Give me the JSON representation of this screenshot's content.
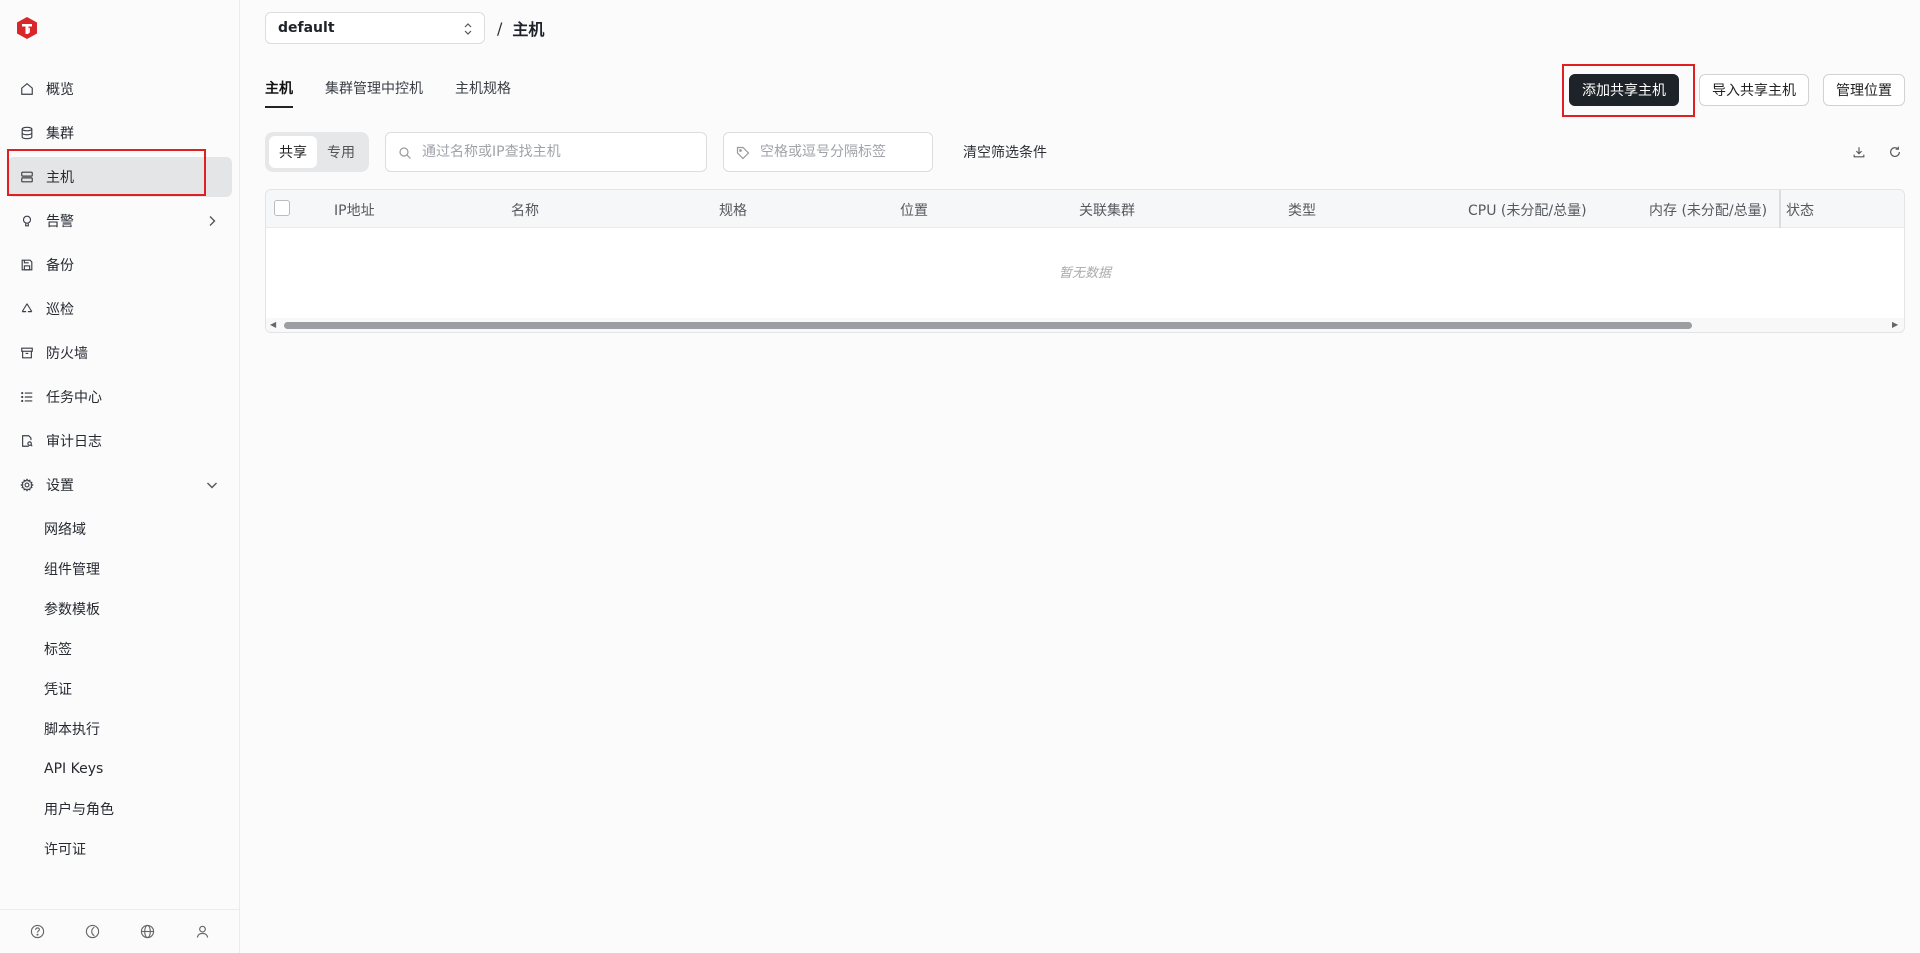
{
  "sidebar": {
    "items": [
      {
        "label": "概览",
        "icon": "home-icon"
      },
      {
        "label": "集群",
        "icon": "database-icon"
      },
      {
        "label": "主机",
        "icon": "server-icon"
      },
      {
        "label": "告警",
        "icon": "bulb-icon"
      },
      {
        "label": "备份",
        "icon": "save-icon"
      },
      {
        "label": "巡检",
        "icon": "recycle-icon"
      },
      {
        "label": "防火墙",
        "icon": "archive-icon"
      },
      {
        "label": "任务中心",
        "icon": "list-icon"
      },
      {
        "label": "审计日志",
        "icon": "file-search-icon"
      },
      {
        "label": "设置",
        "icon": "gear-icon"
      }
    ],
    "settings_children": [
      "网络域",
      "组件管理",
      "参数模板",
      "标签",
      "凭证",
      "脚本执行",
      "API Keys",
      "用户与角色",
      "许可证"
    ],
    "footer_icons": [
      "help-icon",
      "theme-icon",
      "globe-icon",
      "user-icon"
    ]
  },
  "header": {
    "namespace": "default",
    "separator": "/",
    "title": "主机"
  },
  "tabs": [
    "主机",
    "集群管理中控机",
    "主机规格"
  ],
  "actions": {
    "add_shared": "添加共享主机",
    "import_shared": "导入共享主机",
    "manage_location": "管理位置"
  },
  "filters": {
    "segment": [
      "共享",
      "专用"
    ],
    "search_placeholder": "通过名称或IP查找主机",
    "tag_placeholder": "空格或逗号分隔标签",
    "clear": "清空筛选条件"
  },
  "table": {
    "columns": [
      "IP地址",
      "名称",
      "规格",
      "位置",
      "关联集群",
      "类型",
      "CPU (未分配/总量)",
      "内存 (未分配/总量)",
      "状态"
    ],
    "empty_text": "暂无数据"
  },
  "colors": {
    "highlight": "#e02020",
    "primary_button": "#1e2329",
    "active_nav": "#e4e5e7",
    "logo": "#d9262b"
  }
}
